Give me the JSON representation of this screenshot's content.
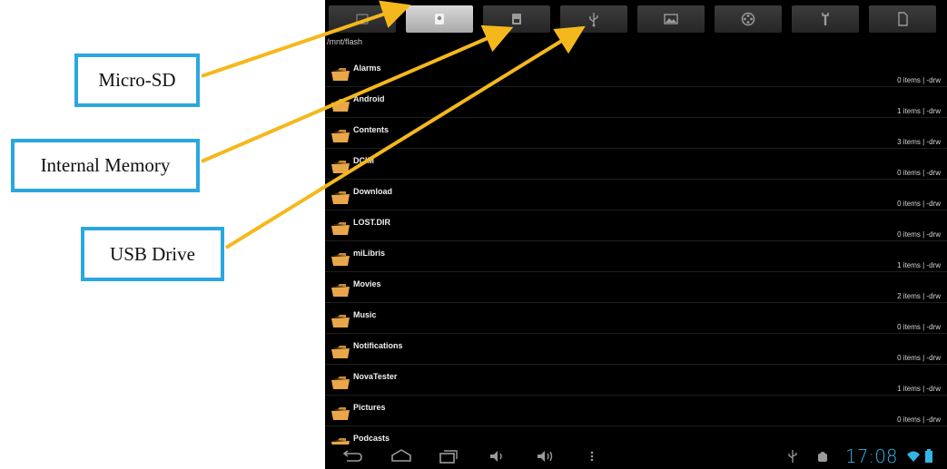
{
  "callouts": {
    "micro_sd": "Micro-SD",
    "internal_memory": "Internal Memory",
    "usb_drive": "USB Drive"
  },
  "tabs": [
    {
      "icon": "storage-icon",
      "active": false
    },
    {
      "icon": "sd-card-icon",
      "active": true
    },
    {
      "icon": "internal-memory-icon",
      "active": false
    },
    {
      "icon": "usb-icon",
      "active": false
    },
    {
      "icon": "picture-icon",
      "active": false
    },
    {
      "icon": "film-reel-icon",
      "active": false
    },
    {
      "icon": "tools-icon",
      "active": false
    },
    {
      "icon": "document-icon",
      "active": false
    }
  ],
  "path": "/mnt/flash",
  "folders": [
    {
      "name": "Alarms",
      "info": "0 items | -drw"
    },
    {
      "name": "Android",
      "info": "1 items | -drw"
    },
    {
      "name": "Contents",
      "info": "3 items | -drw"
    },
    {
      "name": "DCIM",
      "info": "0 items | -drw"
    },
    {
      "name": "Download",
      "info": "0 items | -drw"
    },
    {
      "name": "LOST.DIR",
      "info": "0 items | -drw"
    },
    {
      "name": "miLibris",
      "info": "1 items | -drw"
    },
    {
      "name": "Movies",
      "info": "2 items | -drw"
    },
    {
      "name": "Music",
      "info": "0 items | -drw"
    },
    {
      "name": "Notifications",
      "info": "0 items | -drw"
    },
    {
      "name": "NovaTester",
      "info": "1 items | -drw"
    },
    {
      "name": "Pictures",
      "info": "0 items | -drw"
    },
    {
      "name": "Podcasts",
      "info": ""
    }
  ],
  "status": {
    "clock": "17:08"
  },
  "colors": {
    "callout_border": "#2aa7e0",
    "arrow": "#f5b81c",
    "folder": "#e9a64a",
    "clock": "#33b5e5"
  }
}
